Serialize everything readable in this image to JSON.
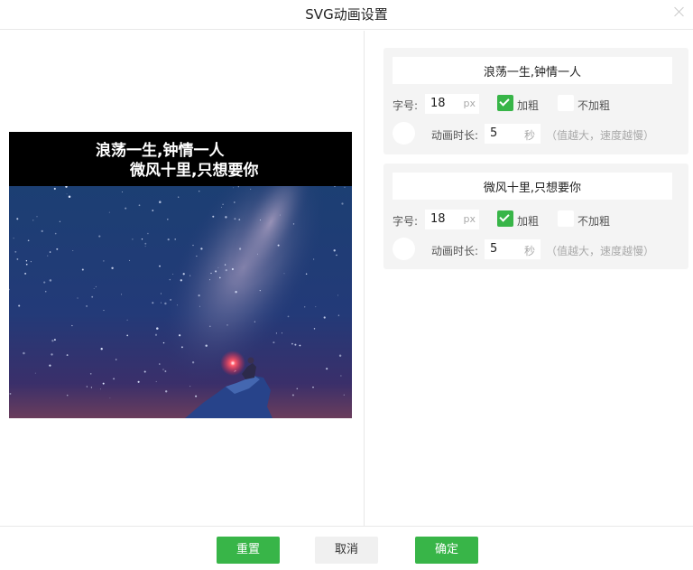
{
  "dialog": {
    "title": "SVG动画设置"
  },
  "preview": {
    "lines": [
      "浪荡一生,钟情一人",
      "微风十里,只想要你"
    ]
  },
  "labels": {
    "font_size": "字号:",
    "px": "px",
    "bold": "加粗",
    "no_bold": "不加粗",
    "duration": "动画时长:",
    "seconds": "秒",
    "hint": "（值越大，速度越慢）"
  },
  "items": [
    {
      "text": "浪荡一生,钟情一人",
      "font_size": "18",
      "bold_checked": true,
      "nobold_checked": false,
      "duration": "5"
    },
    {
      "text": "微风十里,只想要你",
      "font_size": "18",
      "bold_checked": true,
      "nobold_checked": false,
      "duration": "5"
    }
  ],
  "footer": {
    "reset": "重置",
    "cancel": "取消",
    "ok": "确定"
  },
  "colors": {
    "accent": "#38b548",
    "panel": "#f4f4f4"
  }
}
